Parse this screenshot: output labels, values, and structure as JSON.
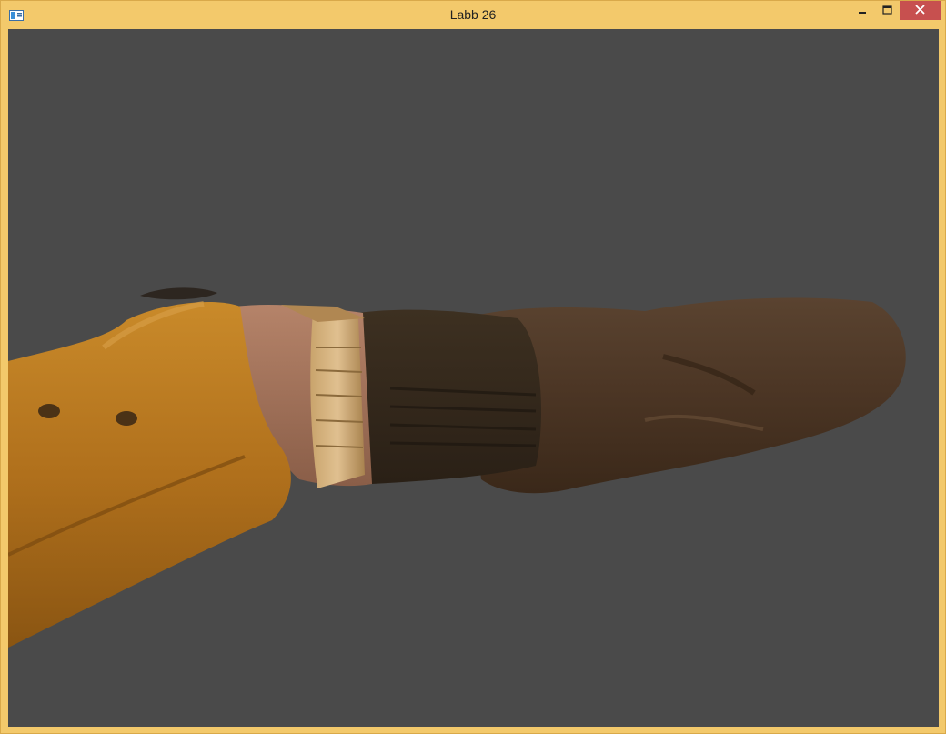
{
  "window": {
    "title": "Labb 26",
    "controls": [
      "minimize",
      "maximize",
      "close"
    ]
  },
  "icons": {
    "app": "app-window-icon",
    "minimize": "minimize-icon",
    "maximize": "maximize-icon",
    "close": "close-icon"
  },
  "colors": {
    "frame": "#f3c96b",
    "viewport_background": "#4a4a4a",
    "close_button": "#c7504f"
  }
}
